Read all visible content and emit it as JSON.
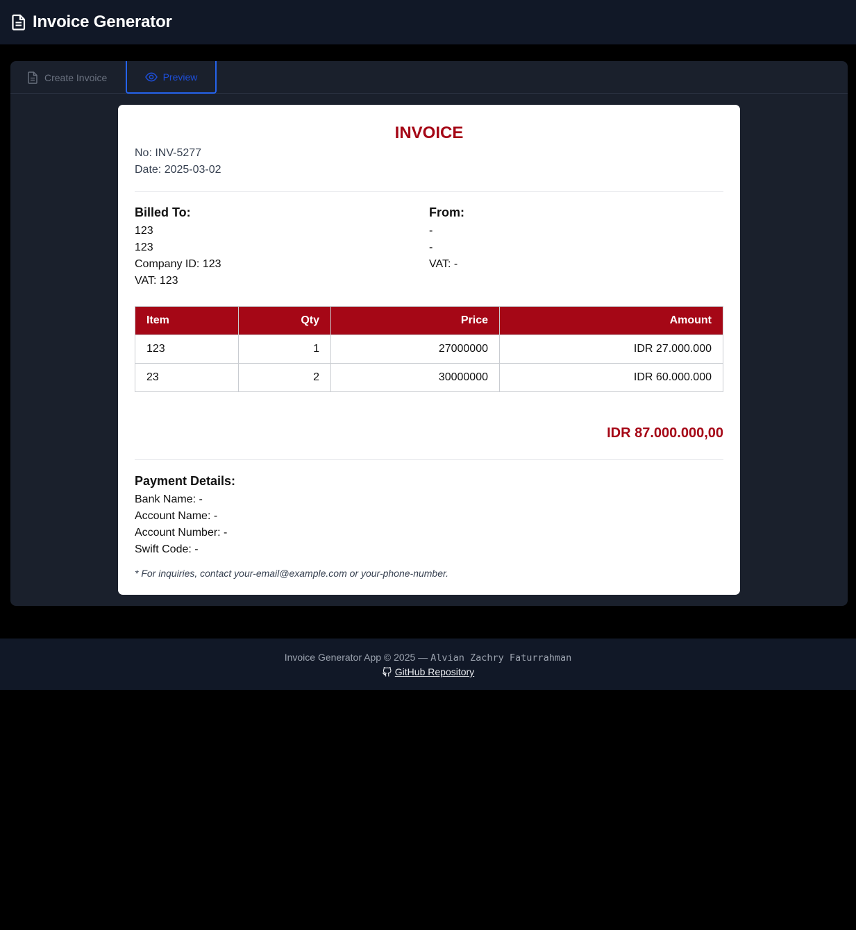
{
  "app": {
    "title": "Invoice Generator"
  },
  "tabs": [
    {
      "label": "Create Invoice",
      "icon": "file-text-icon",
      "active": false
    },
    {
      "label": "Preview",
      "icon": "eye-icon",
      "active": true
    }
  ],
  "invoice": {
    "heading": "INVOICE",
    "number": "No: INV-5277",
    "date": "Date: 2025-03-02",
    "billed_to": {
      "title": "Billed To:",
      "line1": "123",
      "line2": "123",
      "company_id": "Company ID: 123",
      "vat": "VAT: 123"
    },
    "from": {
      "title": "From:",
      "line1": "-",
      "line2": "-",
      "vat": "VAT: -"
    },
    "table": {
      "headers": {
        "item": "Item",
        "qty": "Qty",
        "price": "Price",
        "amount": "Amount"
      },
      "rows": [
        {
          "item": "123",
          "qty": "1",
          "price": "27000000",
          "amount": "IDR 27.000.000"
        },
        {
          "item": "23",
          "qty": "2",
          "price": "30000000",
          "amount": "IDR 60.000.000"
        }
      ]
    },
    "total": "IDR 87.000.000,00",
    "payment": {
      "title": "Payment Details:",
      "bank_name": "Bank Name: -",
      "account_name": "Account Name: -",
      "account_number": "Account Number: -",
      "swift_code": "Swift Code: -"
    },
    "note": "* For inquiries, contact your-email@example.com or your-phone-number."
  },
  "footer": {
    "text": "Invoice Generator App © 2025 —",
    "author": "Alvian Zachry Faturrahman",
    "link_label": "GitHub Repository",
    "link_icon": "github-icon"
  },
  "colors": {
    "accent_red": "#a50716",
    "tab_active_blue": "#2563eb",
    "navbar_bg": "#111827",
    "panel_bg": "#1a202c"
  }
}
